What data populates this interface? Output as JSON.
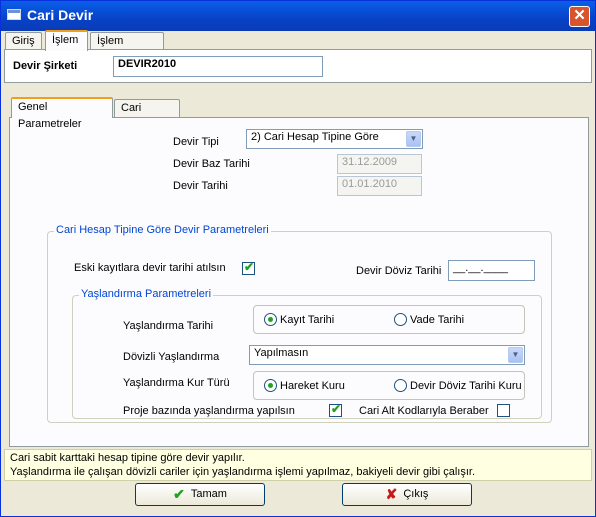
{
  "window": {
    "title": "Cari Devir",
    "close_icon": "close-icon"
  },
  "tabs": [
    "Giriş",
    "İşlem",
    "İşlem Sonucu"
  ],
  "company": {
    "label": "Devir Şirketi",
    "value": "DEVIR2010"
  },
  "subtabs": [
    "Genel Parametreler",
    "Cari Kısıtları"
  ],
  "form": {
    "devir_tipi": {
      "label": "Devir Tipi",
      "value": "2) Cari Hesap Tipine Göre"
    },
    "baz_tarihi": {
      "label": "Devir Baz Tarihi",
      "value": "31.12.2009"
    },
    "devir_tarihi": {
      "label": "Devir Tarihi",
      "value": "01.01.2010"
    }
  },
  "group_devir": {
    "title": "Cari Hesap Tipine Göre Devir Parametreleri",
    "eski_kayit": {
      "label": "Eski kayıtlara devir tarihi atılsın",
      "checked": true
    },
    "doviz_tarihi": {
      "label": "Devir Döviz Tarihi",
      "value": "__.__.____"
    }
  },
  "group_yas": {
    "title": "Yaşlandırma Parametreleri",
    "tarih": {
      "label": "Yaşlandırma Tarihi",
      "options": [
        "Kayıt Tarihi",
        "Vade Tarihi"
      ],
      "selected": "Kayıt Tarihi"
    },
    "dovizli": {
      "label": "Dövizli Yaşlandırma",
      "value": "Yapılmasın"
    },
    "kur": {
      "label": "Yaşlandırma Kur Türü",
      "options": [
        "Hareket Kuru",
        "Devir Döviz Tarihi Kuru"
      ],
      "selected": "Hareket Kuru"
    },
    "proje": {
      "label": "Proje bazında yaşlandırma yapılsın",
      "checked": true
    },
    "alt_kod": {
      "label": "Cari Alt Kodlarıyla Beraber",
      "checked": false
    }
  },
  "status": {
    "line1": "Cari sabit karttaki hesap tipine göre devir yapılır.",
    "line2": "Yaşlandırma ile çalışan dövizli cariler için yaşlandırma işlemi yapılmaz, bakiyeli devir gibi çalışır."
  },
  "buttons": {
    "ok": "Tamam",
    "cancel": "Çıkış"
  },
  "colors": {
    "title_bar": "#0842c7",
    "group_title": "#0046d5",
    "check": "#21a121",
    "status_bg": "#ffffe1"
  }
}
